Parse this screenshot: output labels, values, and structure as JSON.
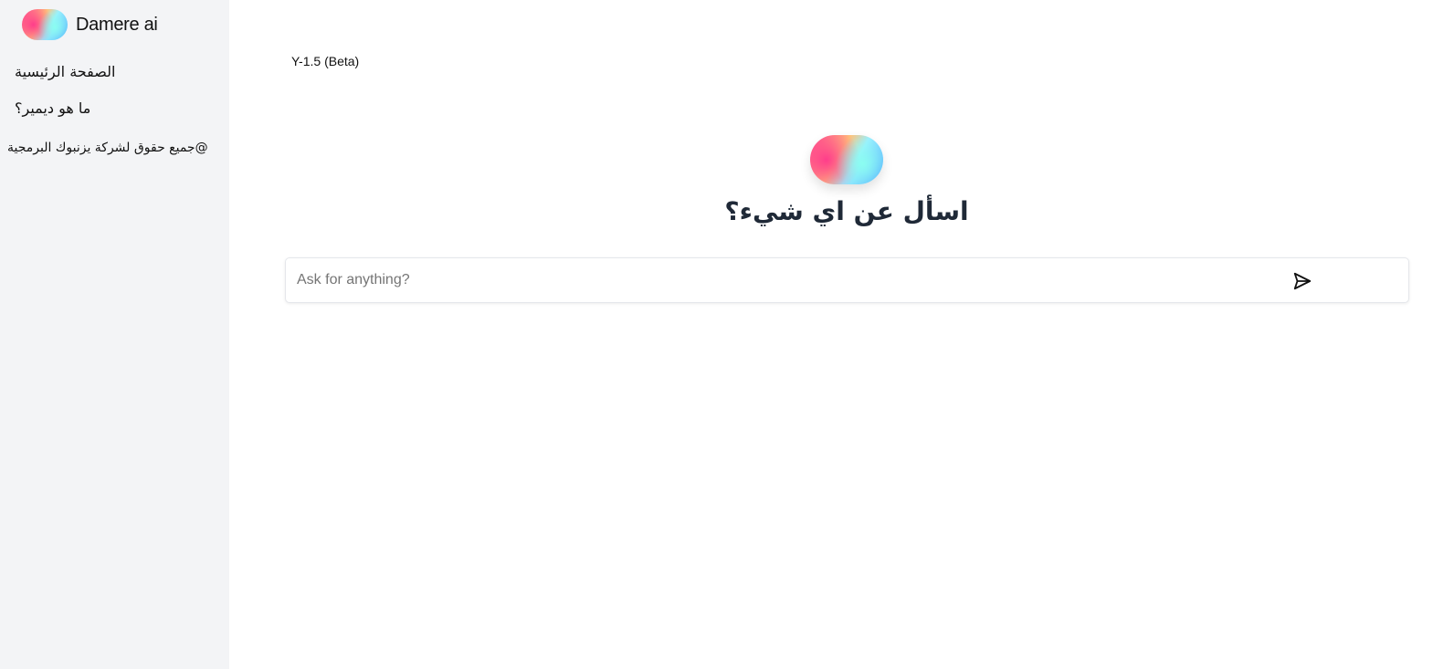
{
  "sidebar": {
    "brand_name": "Damere ai",
    "nav": [
      {
        "label": "الصفحة الرئيسية"
      },
      {
        "label": "ما هو ديمير؟"
      }
    ],
    "copyright": "@جميع حقوق لشركة يزنبوك البرمجية"
  },
  "main": {
    "version": "Y-1.5 (Beta)",
    "heading": "اسأل عن اي شيء؟",
    "search": {
      "placeholder": "Ask for anything?",
      "value": ""
    },
    "send_icon": "send-icon"
  },
  "colors": {
    "sidebar_bg": "#f3f4f6",
    "heading": "#1f2937",
    "logo_pink": "#ff3d8b",
    "logo_blue": "#4aa3ff",
    "logo_cyan": "#8bfff0"
  }
}
